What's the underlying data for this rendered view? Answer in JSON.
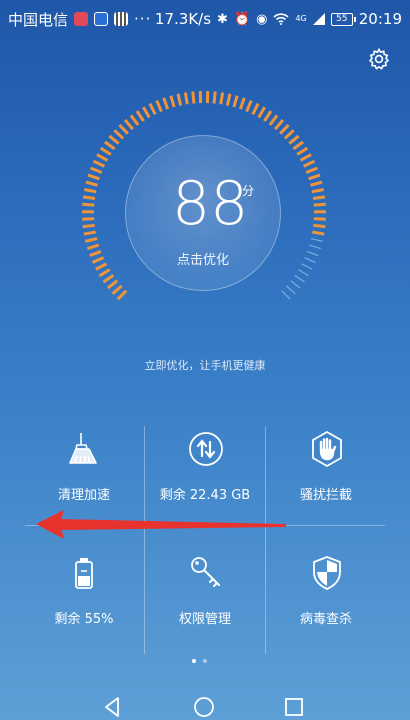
{
  "status_bar": {
    "carrier": "中国电信",
    "network_speed": "17.3K/s",
    "network_type": "4G",
    "battery": "55",
    "time": "20:19"
  },
  "header": {
    "settings_icon": "gear-icon"
  },
  "score": {
    "value": "88",
    "unit": "分",
    "action": "点击优化",
    "level": 0.88
  },
  "hint": "立即优化，让手机更健康",
  "tools": [
    {
      "label": "清理加速",
      "icon": "broom-icon"
    },
    {
      "label": "剩余 22.43 GB",
      "icon": "storage-arrows-icon"
    },
    {
      "label": "骚扰拦截",
      "icon": "hand-stop-icon"
    },
    {
      "label": "剩余 55%",
      "icon": "battery-icon"
    },
    {
      "label": "权限管理",
      "icon": "key-icon"
    },
    {
      "label": "病毒查杀",
      "icon": "shield-icon"
    }
  ],
  "pager": {
    "page": 1,
    "pages": 2
  },
  "colors": {
    "gauge_active": "#f0943a",
    "gauge_inactive": "#9ec3ea",
    "arrow": "#e8322e"
  }
}
